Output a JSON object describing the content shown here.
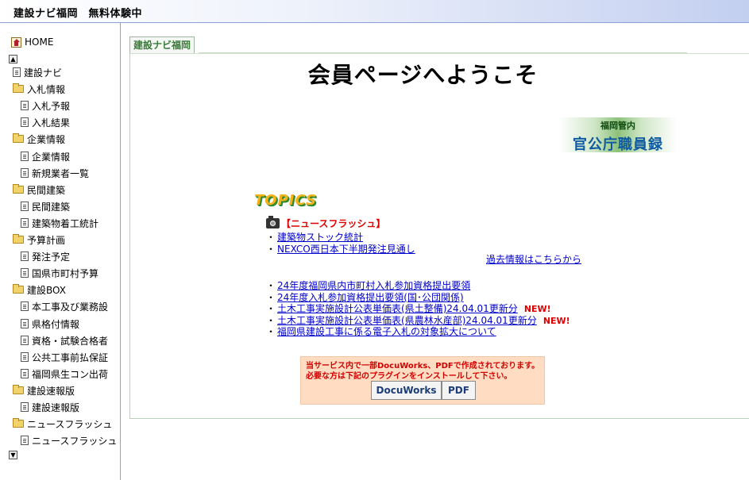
{
  "header": {
    "title": "建設ナビ福岡　無料体験中"
  },
  "sidebar": {
    "home": "HOME",
    "items": [
      {
        "label": "建設ナビ",
        "type": "doc",
        "level": 0
      },
      {
        "label": "入札情報",
        "type": "folder",
        "level": 0
      },
      {
        "label": "入札予報",
        "type": "doc",
        "level": 1
      },
      {
        "label": "入札結果",
        "type": "doc",
        "level": 1
      },
      {
        "label": "企業情報",
        "type": "folder",
        "level": 0
      },
      {
        "label": "企業情報",
        "type": "doc",
        "level": 1
      },
      {
        "label": "新規業者一覧",
        "type": "doc",
        "level": 1
      },
      {
        "label": "民間建築",
        "type": "folder",
        "level": 0
      },
      {
        "label": "民間建築",
        "type": "doc",
        "level": 1
      },
      {
        "label": "建築物着工統計",
        "type": "doc",
        "level": 1
      },
      {
        "label": "予算計画",
        "type": "folder",
        "level": 0
      },
      {
        "label": "発注予定",
        "type": "doc",
        "level": 1
      },
      {
        "label": "国県市町村予算",
        "type": "doc",
        "level": 1
      },
      {
        "label": "建設BOX",
        "type": "folder",
        "level": 0
      },
      {
        "label": "本工事及び業務設",
        "type": "doc",
        "level": 1
      },
      {
        "label": "県格付情報",
        "type": "doc",
        "level": 1
      },
      {
        "label": "資格・試験合格者",
        "type": "doc",
        "level": 1
      },
      {
        "label": "公共工事前払保証",
        "type": "doc",
        "level": 1
      },
      {
        "label": "福岡県生コン出荷",
        "type": "doc",
        "level": 1
      },
      {
        "label": "建設速報版",
        "type": "folder",
        "level": 0
      },
      {
        "label": "建設速報版",
        "type": "doc",
        "level": 1
      },
      {
        "label": "ニュースフラッシュ",
        "type": "folder",
        "level": 0
      },
      {
        "label": "ニュースフラッシュ",
        "type": "doc",
        "level": 1
      }
    ]
  },
  "main": {
    "tab": "建設ナビ福岡",
    "welcome": "会員ページへようこそ",
    "banner": {
      "sub": "福岡管内",
      "main": "官公庁職員録"
    },
    "topics": "TOPICS",
    "news_label": "【ニュースフラッシュ】",
    "news_links": [
      "建築物ストック統計",
      "NEXCO西日本下半期発注見通し"
    ],
    "past_link": "過去情報はこちらから",
    "info_links": [
      {
        "text": "24年度福岡県内市町村入札参加資格提出要領",
        "new": ""
      },
      {
        "text": "24年度入札参加資格提出要領(国･公団関係)",
        "new": ""
      },
      {
        "text": "土木工事実施設計公表単価表(県土整備)24.04.01更新分",
        "new": "NEW!"
      },
      {
        "text": "土木工事実施設計公表単価表(県農林水産部)24.04.01更新分",
        "new": "NEW!"
      },
      {
        "text": "福岡県建設工事に係る電子入札の対象拡大について",
        "new": ""
      }
    ],
    "plugin": {
      "line1": "当サービス内で一部DocuWorks、PDFで作成されております。",
      "line2": "必要な方は下記のプラグインをインストールして下さい。",
      "docuworks": "DocuWorks",
      "pdf": "PDF"
    }
  }
}
